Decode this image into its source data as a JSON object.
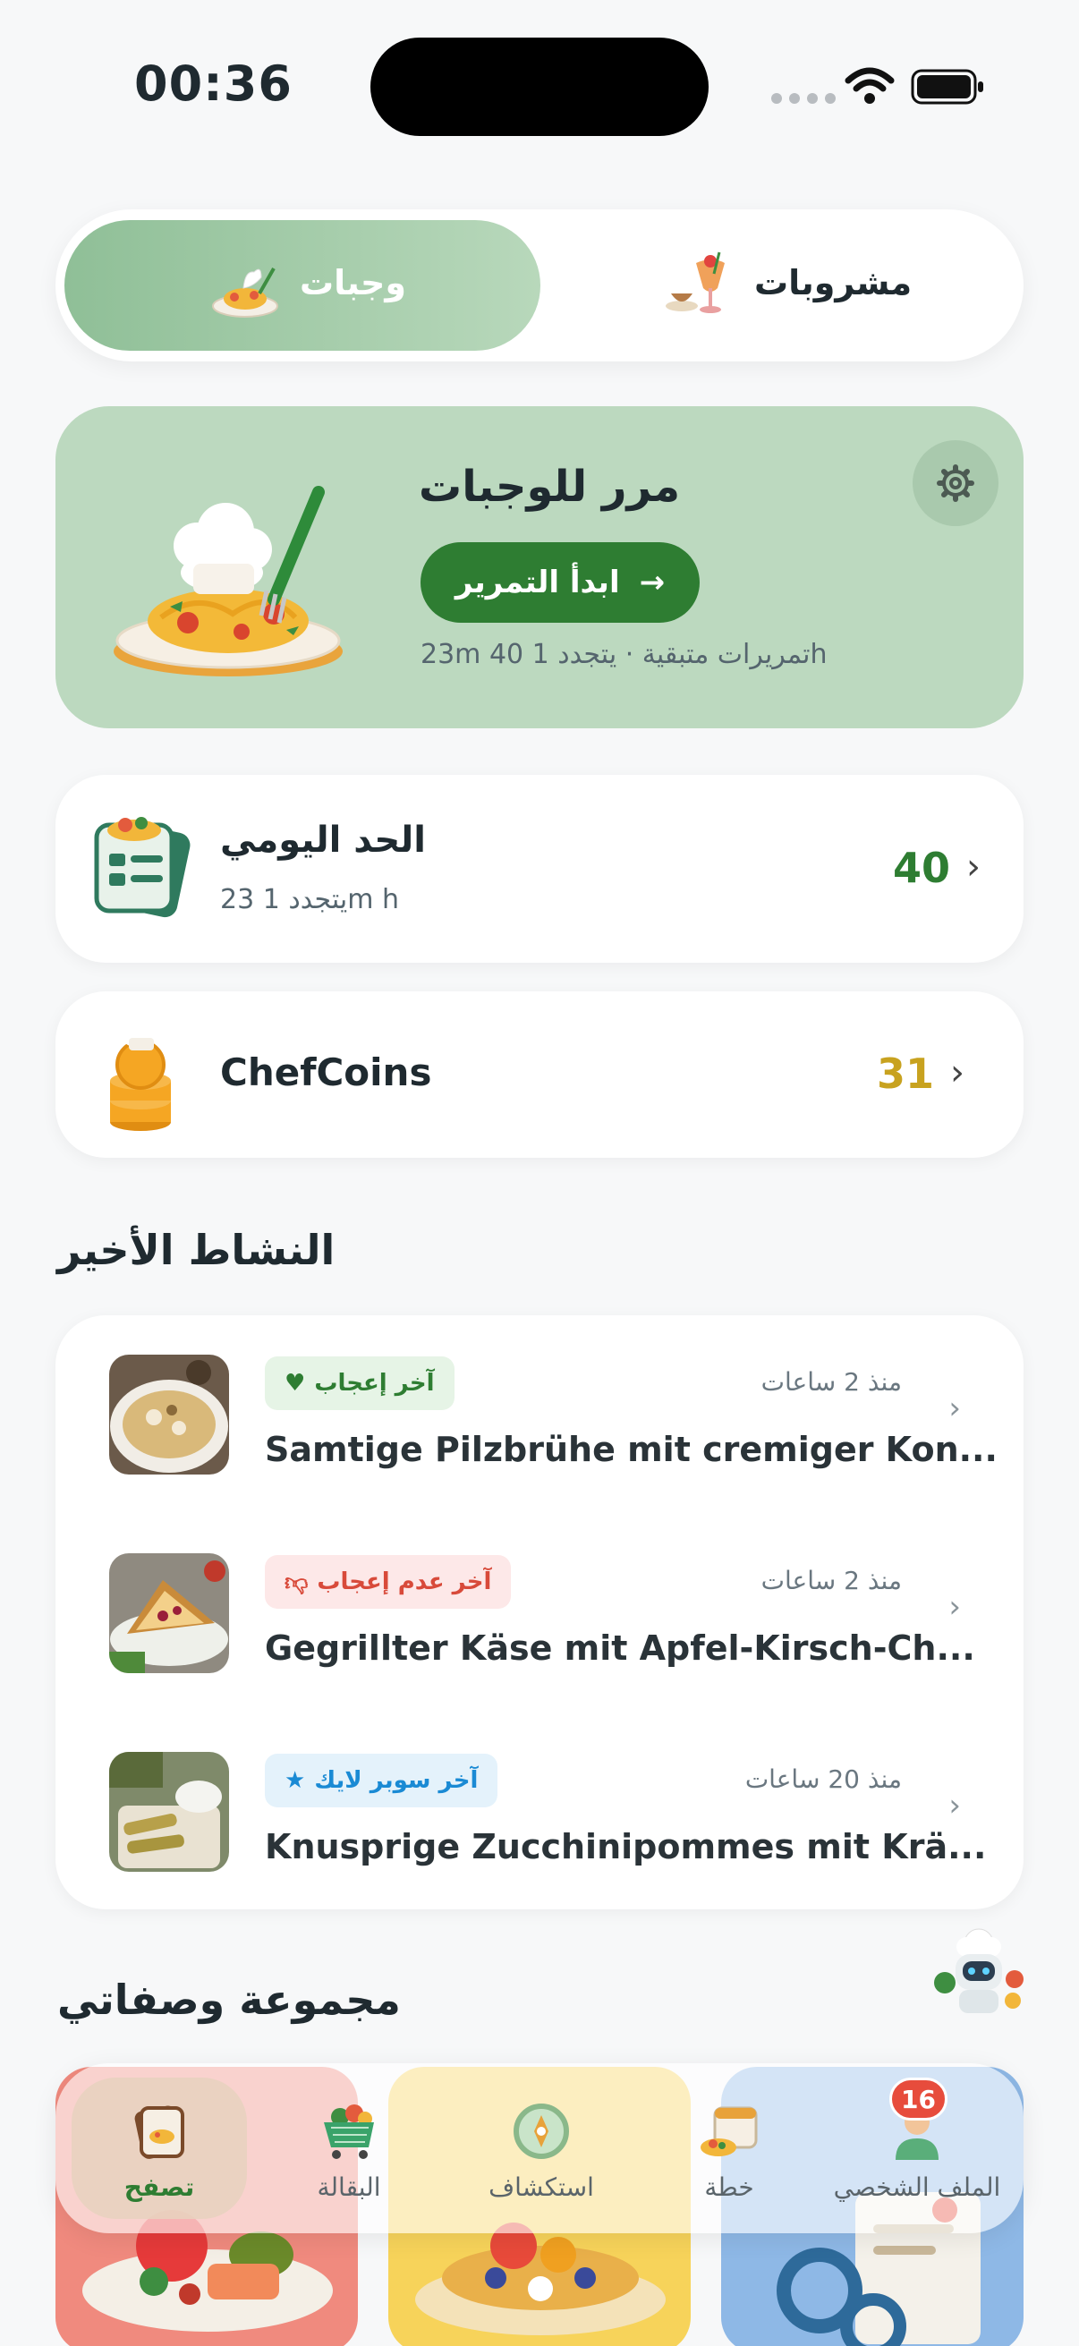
{
  "status_bar": {
    "time": "00:36"
  },
  "segments": [
    {
      "label": "وجبات",
      "active": true,
      "icon": "pasta-plate-icon"
    },
    {
      "label": "مشروبات",
      "active": false,
      "icon": "drinks-icon"
    }
  ],
  "hero": {
    "title": "مرر للوجبات",
    "button_label": "ابدأ التمرير",
    "subtitle": "23m تمريرات متبقية · يتجدد 1 40h"
  },
  "daily_limit": {
    "title": "الحد اليومي",
    "subtitle": "يتجدد 1 23m h",
    "count": "40"
  },
  "chefcoins": {
    "title": "ChefCoins",
    "count": "31"
  },
  "recent_activity": {
    "title": "النشاط الأخير",
    "items": [
      {
        "badge": "آخر إعجاب",
        "badge_icon": "heart-icon",
        "time": "منذ 2 ساعات",
        "name": "Samtige Pilzbrühe mit cremiger Kon..."
      },
      {
        "badge": "آخر عدم إعجاب",
        "badge_icon": "thumbs-down-icon",
        "time": "منذ 2 ساعات",
        "name": "Gegrillter Käse mit Apfel-Kirsch-Ch..."
      },
      {
        "badge": "آخر سوبر لايك",
        "badge_icon": "star-icon",
        "time": "منذ 20 ساعات",
        "name": "Knusprige Zucchinipommes mit Krä..."
      }
    ]
  },
  "collection": {
    "title": "مجموعة وصفاتي"
  },
  "tabbar": {
    "tabs": [
      {
        "label": "تصفح",
        "icon": "browse-cards-icon",
        "active": true
      },
      {
        "label": "البقالة",
        "icon": "grocery-cart-icon",
        "active": false
      },
      {
        "label": "استكشاف",
        "icon": "compass-icon",
        "active": false
      },
      {
        "label": "خطة",
        "icon": "calendar-plan-icon",
        "active": false
      },
      {
        "label": "الملف الشخصي",
        "icon": "profile-icon",
        "active": false
      }
    ],
    "notification_count": "16"
  },
  "colors": {
    "accent": "#2e7d32",
    "hero_bg": "#bcd9bf",
    "coins": "#c8a21f"
  }
}
